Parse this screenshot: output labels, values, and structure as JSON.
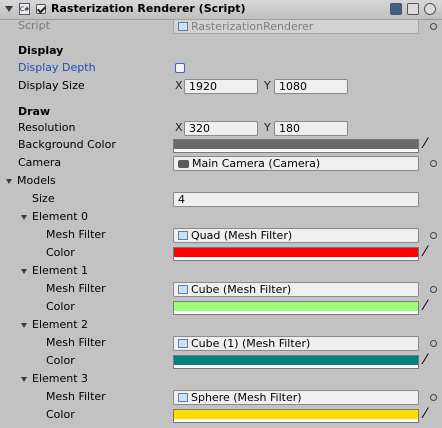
{
  "header": {
    "title": "Rasterization Renderer (Script)",
    "enabled": true,
    "script_icon": "cs-script-icon",
    "help_icon": "book-help-icon",
    "settings_icon": "gear-icon",
    "menu_icon": "gear-dropdown-icon"
  },
  "script": {
    "label": "Script",
    "value": "RasterizationRenderer"
  },
  "display": {
    "heading": "Display",
    "depth_label": "Display Depth",
    "depth_value": false,
    "size_label": "Display Size",
    "x_label": "X",
    "x_value": "1920",
    "y_label": "Y",
    "y_value": "1080"
  },
  "draw": {
    "heading": "Draw",
    "resolution_label": "Resolution",
    "x_label": "X",
    "x_value": "320",
    "y_label": "Y",
    "y_value": "180",
    "background_label": "Background Color",
    "background_color": "#6a6a6a",
    "camera_label": "Camera",
    "camera_value": "Main Camera (Camera)"
  },
  "models": {
    "label": "Models",
    "size_label": "Size",
    "size_value": "4",
    "elements": [
      {
        "label": "Element 0",
        "mesh_label": "Mesh Filter",
        "mesh_value": "Quad (Mesh Filter)",
        "color_label": "Color",
        "color": "#ff0000"
      },
      {
        "label": "Element 1",
        "mesh_label": "Mesh Filter",
        "mesh_value": "Cube (Mesh Filter)",
        "color_label": "Color",
        "color": "#99ff77"
      },
      {
        "label": "Element 2",
        "mesh_label": "Mesh Filter",
        "mesh_value": "Cube (1) (Mesh Filter)",
        "color_label": "Color",
        "color": "#008080"
      },
      {
        "label": "Element 3",
        "mesh_label": "Mesh Filter",
        "mesh_value": "Sphere (Mesh Filter)",
        "color_label": "Color",
        "color": "#ffdd00"
      }
    ]
  }
}
